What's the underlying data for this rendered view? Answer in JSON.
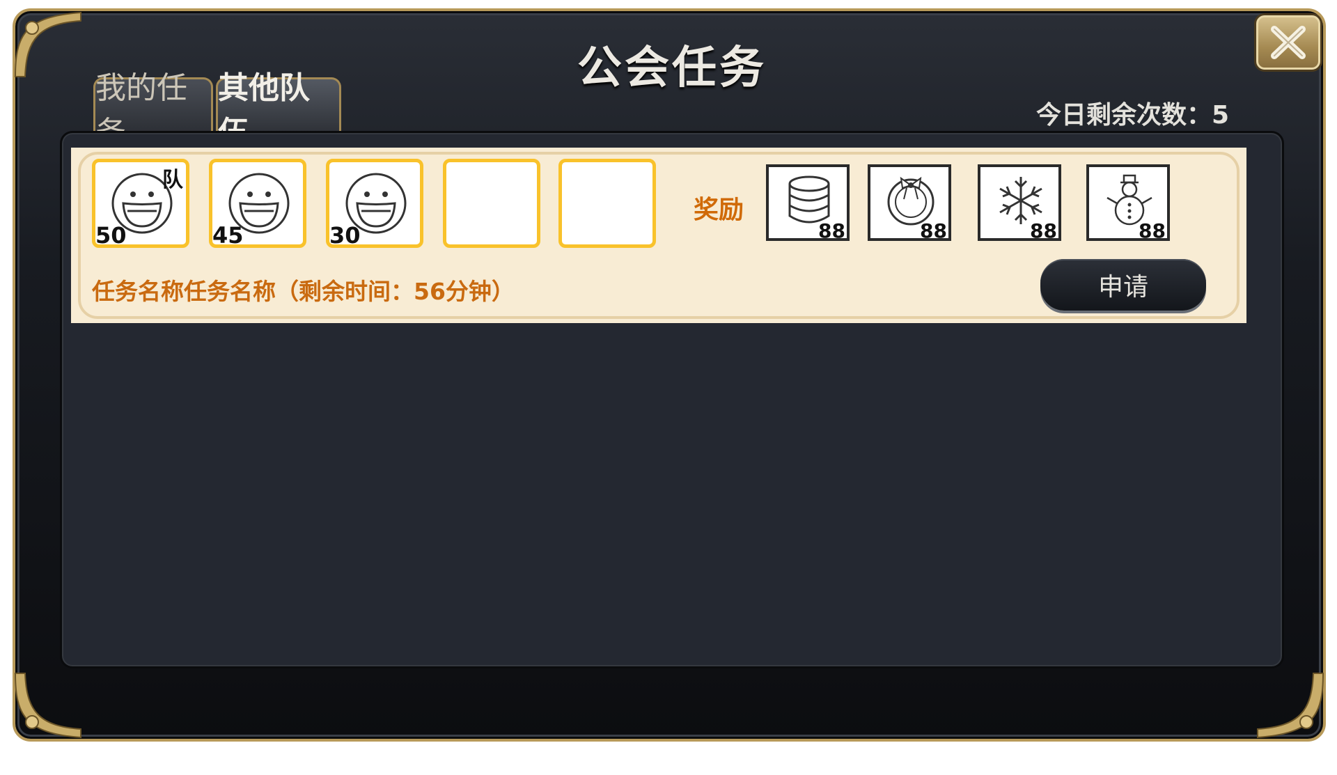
{
  "dialog": {
    "title": "公会任务",
    "remaining_label": "今日剩余次数：5"
  },
  "tabs": [
    {
      "label": "我的任务",
      "active": false
    },
    {
      "label": "其他队伍",
      "active": true
    }
  ],
  "task": {
    "members": [
      {
        "level": "50",
        "badge": "队",
        "icon": "smiley-face-icon"
      },
      {
        "level": "45",
        "badge": "",
        "icon": "smiley-face-icon"
      },
      {
        "level": "30",
        "badge": "",
        "icon": "smiley-face-icon"
      },
      {
        "level": "",
        "badge": "",
        "icon": ""
      },
      {
        "level": "",
        "badge": "",
        "icon": ""
      }
    ],
    "reward_label": "奖励",
    "rewards": [
      {
        "icon": "database-icon",
        "count": "88"
      },
      {
        "icon": "wreath-icon",
        "count": "88"
      },
      {
        "icon": "snowflake-icon",
        "count": "88"
      },
      {
        "icon": "snowman-icon",
        "count": "88"
      }
    ],
    "name_text": "任务名称任务名称（剩余时间：56分钟）",
    "apply_label": "申请"
  },
  "colors": {
    "slot_border": "#f9c22b",
    "reward_text": "#d06a08",
    "task_text": "#c96a10",
    "row_bg": "#f8ecd4",
    "frame_gold": "#b89a5a"
  }
}
